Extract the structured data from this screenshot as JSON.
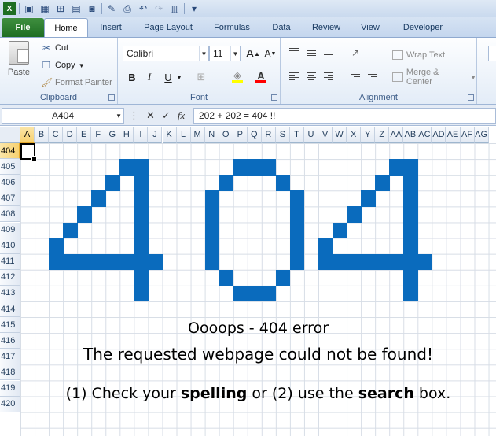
{
  "qat": {
    "icons": [
      "excel-icon",
      "save-icon",
      "calculator-icon",
      "table-icon",
      "grid-icon",
      "camera-icon",
      "edit-icon",
      "print-icon",
      "undo-icon",
      "redo-icon",
      "form-icon",
      "customize-icon"
    ]
  },
  "tabs": [
    {
      "label": "File",
      "name": "tab-file"
    },
    {
      "label": "Home",
      "name": "tab-home"
    },
    {
      "label": "Insert",
      "name": "tab-insert"
    },
    {
      "label": "Page Layout",
      "name": "tab-page-layout"
    },
    {
      "label": "Formulas",
      "name": "tab-formulas"
    },
    {
      "label": "Data",
      "name": "tab-data"
    },
    {
      "label": "Review",
      "name": "tab-review"
    },
    {
      "label": "View",
      "name": "tab-view"
    },
    {
      "label": "Developer",
      "name": "tab-developer"
    }
  ],
  "active_tab": "Home",
  "ribbon": {
    "clipboard": {
      "label": "Clipboard",
      "paste": "Paste",
      "cut": "Cut",
      "copy": "Copy",
      "format_painter": "Format Painter"
    },
    "font": {
      "label": "Font",
      "font_name": "Calibri",
      "font_size": "11",
      "bold": "B",
      "italic": "I",
      "underline": "U",
      "font_color_letter": "A",
      "fill_color": "#ffff00",
      "font_color": "#ff0000"
    },
    "alignment": {
      "label": "Alignment",
      "wrap_text": "Wrap Text",
      "merge_center": "Merge & Center"
    }
  },
  "formula_bar": {
    "name_box": "A404",
    "fx": "fx",
    "formula": "202 + 202 = 404 !!"
  },
  "sheet": {
    "columns": [
      "A",
      "B",
      "C",
      "D",
      "E",
      "F",
      "G",
      "H",
      "I",
      "J",
      "K",
      "L",
      "M",
      "N",
      "O",
      "P",
      "Q",
      "R",
      "S",
      "T",
      "U",
      "V",
      "W",
      "X",
      "Y",
      "Z",
      "AA",
      "AB",
      "AC",
      "AD",
      "AE",
      "AF",
      "AG"
    ],
    "rows": [
      "404",
      "405",
      "406",
      "407",
      "408",
      "409",
      "410",
      "411",
      "412",
      "413",
      "414",
      "415",
      "416",
      "417",
      "418",
      "419",
      "420"
    ],
    "selected_column": "A",
    "selected_row": "404",
    "pixel_color": "#0a6bbd",
    "message": {
      "line1": "Oooops - 404 error",
      "line2": "The requested webpage could not be found!",
      "line3_a": "(1) Check your ",
      "line3_b": "spelling",
      "line3_c": " or (2) use the ",
      "line3_d": "search",
      "line3_e": " box."
    }
  }
}
